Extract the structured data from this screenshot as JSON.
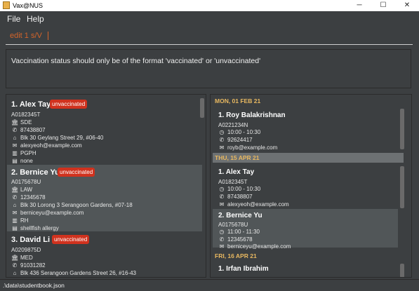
{
  "window": {
    "title": "Vax@NUS",
    "min": "─",
    "max": "☐",
    "close": "✕"
  },
  "menu": {
    "file": "File",
    "help": "Help"
  },
  "command": {
    "text": "edit 1 s/V"
  },
  "result": {
    "text": "Vaccination status should only be of the format 'vaccinated' or 'unvaccinated'"
  },
  "students": [
    {
      "index_name": "1.  Alex Tay",
      "status": "unvaccinated",
      "id": "A0182345T",
      "faculty": "SDE",
      "phone": "87438807",
      "address": "Blk 30 Geylang Street 29, #06-40",
      "email": "alexyeoh@example.com",
      "residence": "PGPH",
      "medical": "none"
    },
    {
      "index_name": "2.  Bernice Yu",
      "status": "unvaccinated",
      "id": "A0175678U",
      "faculty": "LAW",
      "phone": "12345678",
      "address": "Blk 30 Lorong 3 Serangoon Gardens, #07-18",
      "email": "berniceyu@example.com",
      "residence": "RH",
      "medical": "shellfish allergy"
    },
    {
      "index_name": "3.  David Li",
      "status": "unvaccinated",
      "id": "A0209875D",
      "faculty": "MED",
      "phone": "91031282",
      "address": "Blk 436 Serangoon Gardens Street 26, #16-43"
    }
  ],
  "schedule": [
    {
      "date": "MON, 01 FEB 21",
      "appointments": [
        {
          "index_name": "1.  Roy Balakrishnan",
          "id": "A0221234N",
          "time": "10:00 - 10:30",
          "phone": "92624417",
          "email": "royb@example.com"
        }
      ]
    },
    {
      "date": "THU, 15 APR 21",
      "appointments": [
        {
          "index_name": "1.  Alex Tay",
          "id": "A0182345T",
          "time": "10:00 - 10:30",
          "phone": "87438807",
          "email": "alexyeoh@example.com"
        },
        {
          "index_name": "2.  Bernice Yu",
          "id": "A0175678U",
          "time": "11:00 - 11:30",
          "phone": "12345678",
          "email": "berniceyu@example.com"
        }
      ]
    },
    {
      "date": "FRI, 16 APR 21",
      "appointments": [
        {
          "index_name": "1.  Irfan Ibrahim"
        }
      ]
    }
  ],
  "status_bar": {
    "path": ".\\data\\studentbook.json"
  },
  "colors": {
    "badge": "#d0321e",
    "date_header": "#e8b860",
    "command_text": "#d4642a"
  }
}
